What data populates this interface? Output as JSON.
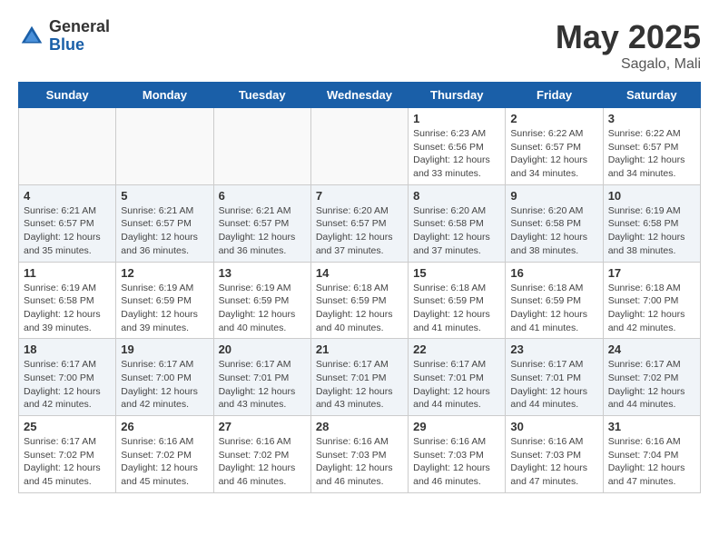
{
  "header": {
    "logo_general": "General",
    "logo_blue": "Blue",
    "month_year": "May 2025",
    "location": "Sagalo, Mali"
  },
  "weekdays": [
    "Sunday",
    "Monday",
    "Tuesday",
    "Wednesday",
    "Thursday",
    "Friday",
    "Saturday"
  ],
  "weeks": [
    [
      {
        "day": "",
        "info": ""
      },
      {
        "day": "",
        "info": ""
      },
      {
        "day": "",
        "info": ""
      },
      {
        "day": "",
        "info": ""
      },
      {
        "day": "1",
        "info": "Sunrise: 6:23 AM\nSunset: 6:56 PM\nDaylight: 12 hours\nand 33 minutes."
      },
      {
        "day": "2",
        "info": "Sunrise: 6:22 AM\nSunset: 6:57 PM\nDaylight: 12 hours\nand 34 minutes."
      },
      {
        "day": "3",
        "info": "Sunrise: 6:22 AM\nSunset: 6:57 PM\nDaylight: 12 hours\nand 34 minutes."
      }
    ],
    [
      {
        "day": "4",
        "info": "Sunrise: 6:21 AM\nSunset: 6:57 PM\nDaylight: 12 hours\nand 35 minutes."
      },
      {
        "day": "5",
        "info": "Sunrise: 6:21 AM\nSunset: 6:57 PM\nDaylight: 12 hours\nand 36 minutes."
      },
      {
        "day": "6",
        "info": "Sunrise: 6:21 AM\nSunset: 6:57 PM\nDaylight: 12 hours\nand 36 minutes."
      },
      {
        "day": "7",
        "info": "Sunrise: 6:20 AM\nSunset: 6:57 PM\nDaylight: 12 hours\nand 37 minutes."
      },
      {
        "day": "8",
        "info": "Sunrise: 6:20 AM\nSunset: 6:58 PM\nDaylight: 12 hours\nand 37 minutes."
      },
      {
        "day": "9",
        "info": "Sunrise: 6:20 AM\nSunset: 6:58 PM\nDaylight: 12 hours\nand 38 minutes."
      },
      {
        "day": "10",
        "info": "Sunrise: 6:19 AM\nSunset: 6:58 PM\nDaylight: 12 hours\nand 38 minutes."
      }
    ],
    [
      {
        "day": "11",
        "info": "Sunrise: 6:19 AM\nSunset: 6:58 PM\nDaylight: 12 hours\nand 39 minutes."
      },
      {
        "day": "12",
        "info": "Sunrise: 6:19 AM\nSunset: 6:59 PM\nDaylight: 12 hours\nand 39 minutes."
      },
      {
        "day": "13",
        "info": "Sunrise: 6:19 AM\nSunset: 6:59 PM\nDaylight: 12 hours\nand 40 minutes."
      },
      {
        "day": "14",
        "info": "Sunrise: 6:18 AM\nSunset: 6:59 PM\nDaylight: 12 hours\nand 40 minutes."
      },
      {
        "day": "15",
        "info": "Sunrise: 6:18 AM\nSunset: 6:59 PM\nDaylight: 12 hours\nand 41 minutes."
      },
      {
        "day": "16",
        "info": "Sunrise: 6:18 AM\nSunset: 6:59 PM\nDaylight: 12 hours\nand 41 minutes."
      },
      {
        "day": "17",
        "info": "Sunrise: 6:18 AM\nSunset: 7:00 PM\nDaylight: 12 hours\nand 42 minutes."
      }
    ],
    [
      {
        "day": "18",
        "info": "Sunrise: 6:17 AM\nSunset: 7:00 PM\nDaylight: 12 hours\nand 42 minutes."
      },
      {
        "day": "19",
        "info": "Sunrise: 6:17 AM\nSunset: 7:00 PM\nDaylight: 12 hours\nand 42 minutes."
      },
      {
        "day": "20",
        "info": "Sunrise: 6:17 AM\nSunset: 7:01 PM\nDaylight: 12 hours\nand 43 minutes."
      },
      {
        "day": "21",
        "info": "Sunrise: 6:17 AM\nSunset: 7:01 PM\nDaylight: 12 hours\nand 43 minutes."
      },
      {
        "day": "22",
        "info": "Sunrise: 6:17 AM\nSunset: 7:01 PM\nDaylight: 12 hours\nand 44 minutes."
      },
      {
        "day": "23",
        "info": "Sunrise: 6:17 AM\nSunset: 7:01 PM\nDaylight: 12 hours\nand 44 minutes."
      },
      {
        "day": "24",
        "info": "Sunrise: 6:17 AM\nSunset: 7:02 PM\nDaylight: 12 hours\nand 44 minutes."
      }
    ],
    [
      {
        "day": "25",
        "info": "Sunrise: 6:17 AM\nSunset: 7:02 PM\nDaylight: 12 hours\nand 45 minutes."
      },
      {
        "day": "26",
        "info": "Sunrise: 6:16 AM\nSunset: 7:02 PM\nDaylight: 12 hours\nand 45 minutes."
      },
      {
        "day": "27",
        "info": "Sunrise: 6:16 AM\nSunset: 7:02 PM\nDaylight: 12 hours\nand 46 minutes."
      },
      {
        "day": "28",
        "info": "Sunrise: 6:16 AM\nSunset: 7:03 PM\nDaylight: 12 hours\nand 46 minutes."
      },
      {
        "day": "29",
        "info": "Sunrise: 6:16 AM\nSunset: 7:03 PM\nDaylight: 12 hours\nand 46 minutes."
      },
      {
        "day": "30",
        "info": "Sunrise: 6:16 AM\nSunset: 7:03 PM\nDaylight: 12 hours\nand 47 minutes."
      },
      {
        "day": "31",
        "info": "Sunrise: 6:16 AM\nSunset: 7:04 PM\nDaylight: 12 hours\nand 47 minutes."
      }
    ]
  ]
}
